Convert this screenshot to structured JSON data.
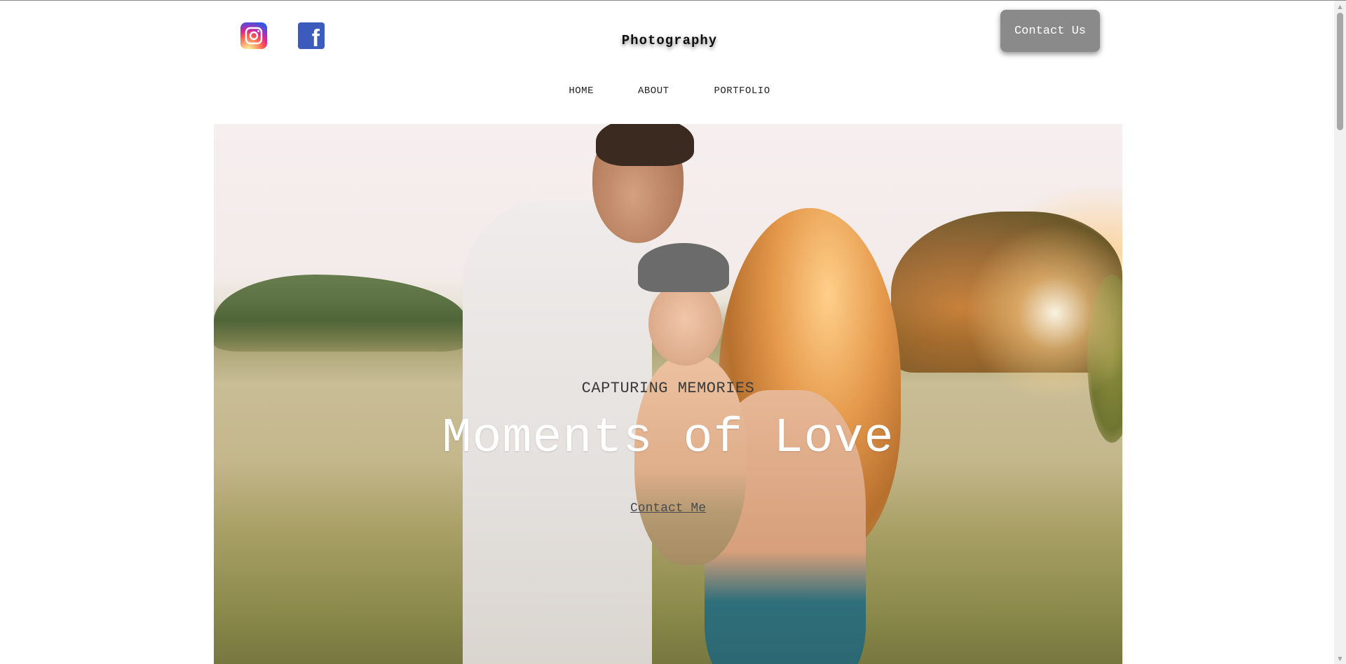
{
  "header": {
    "brand": "Photography",
    "contact_button": "Contact Us",
    "social": [
      {
        "name": "instagram-icon",
        "color": "#d6249f"
      },
      {
        "name": "facebook-icon",
        "color": "#3b5bbd",
        "glyph": "f"
      }
    ]
  },
  "nav": {
    "items": [
      {
        "label": "HOME"
      },
      {
        "label": "ABOUT"
      },
      {
        "label": "PORTFOLIO"
      }
    ]
  },
  "hero": {
    "kicker": "CAPTURING MEMORIES",
    "title": "Moments of Love",
    "cta_link": "Contact Me"
  },
  "colors": {
    "contact_button_bg": "#8a8a8a",
    "hero_title": "#ffffff"
  }
}
